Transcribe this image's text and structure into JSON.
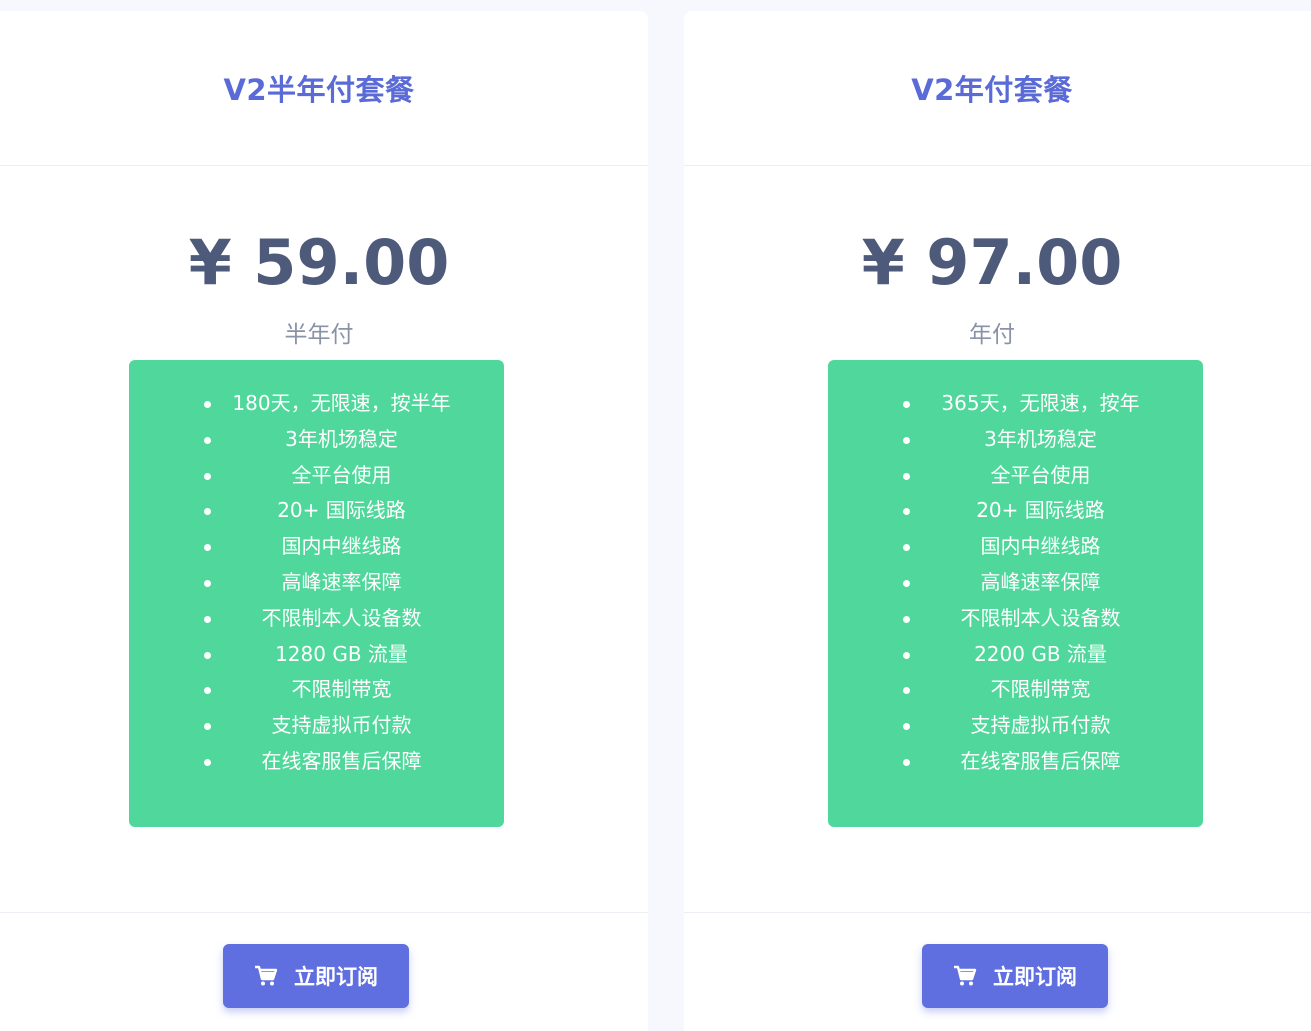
{
  "plans": [
    {
      "title": "V2半年付套餐",
      "price": "¥ 59.00",
      "period": "半年付",
      "features": [
        "180天，无限速，按半年",
        "3年机场稳定",
        "全平台使用",
        "20+ 国际线路",
        "国内中继线路",
        "高峰速率保障",
        "不限制本人设备数",
        "1280 GB 流量",
        "不限制带宽",
        "支持虚拟币付款",
        "在线客服售后保障"
      ],
      "button_label": "立即订阅",
      "button_icon": "cart-icon"
    },
    {
      "title": "V2年付套餐",
      "price": "¥ 97.00",
      "period": "年付",
      "features": [
        "365天，无限速，按年",
        "3年机场稳定",
        "全平台使用",
        "20+ 国际线路",
        "国内中继线路",
        "高峰速率保障",
        "不限制本人设备数",
        "2200 GB 流量",
        "不限制带宽",
        "支持虚拟币付款",
        "在线客服售后保障"
      ],
      "button_label": "立即订阅",
      "button_icon": "cart-icon"
    }
  ],
  "colors": {
    "title": "#5a6ad6",
    "price": "#4d5a7a",
    "period": "#8a92a6",
    "features_bg": "#50d79b",
    "button_bg": "#5f6fe0",
    "page_bg": "#f7f8fd"
  }
}
